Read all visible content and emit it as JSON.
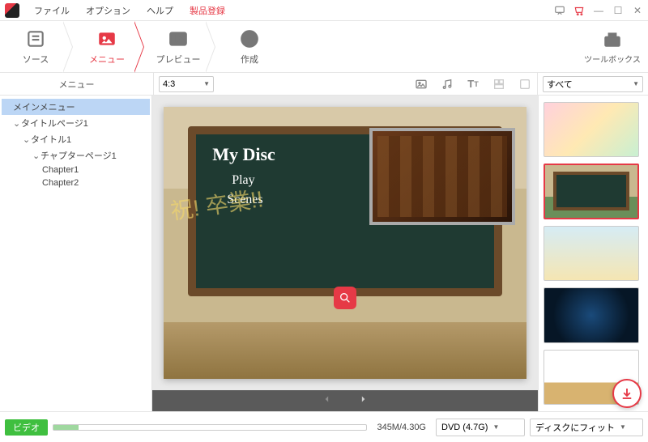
{
  "menubar": {
    "file": "ファイル",
    "options": "オプション",
    "help": "ヘルプ",
    "register": "製品登録"
  },
  "tabs": {
    "source": "ソース",
    "menu": "メニュー",
    "preview": "プレビュー",
    "create": "作成",
    "toolbox": "ツールボックス"
  },
  "secbar": {
    "left_label": "メニュー",
    "ratio": "4:3",
    "filter": "すべて"
  },
  "tree": {
    "main": "メインメニュー",
    "titlepage": "タイトルページ1",
    "title1": "タイトル1",
    "chapterpage": "チャプターページ1",
    "chapter1": "Chapter1",
    "chapter2": "Chapter2"
  },
  "disc": {
    "title": "My Disc",
    "play": "Play",
    "scenes": "Scenes",
    "grad": "祝! 卒業!!"
  },
  "bottom": {
    "video_label": "ビデオ",
    "size": "345M/4.30G",
    "disc_type": "DVD (4.7G)",
    "fit": "ディスクにフィット"
  }
}
